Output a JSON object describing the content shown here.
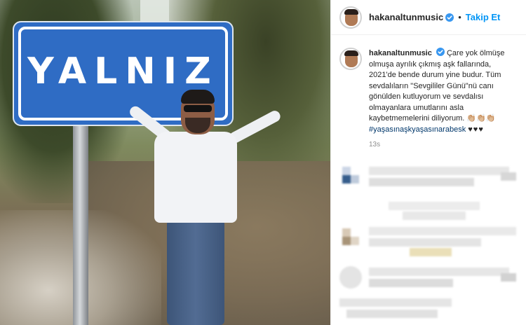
{
  "photo": {
    "sign_text": "YALNIZ"
  },
  "header": {
    "username": "hakanaltunmusic",
    "separator": "•",
    "follow_label": "Takip Et"
  },
  "caption": {
    "username": "hakanaltunmusic",
    "text": "Çare yok ölmüşe olmuşa ayrılık çıkmış aşk fallarında, 2021'de bende durum yine budur. Tüm sevdalıların \"Sevgililer Günü\"nü canı gönülden kutluyorum ve sevdalısı olmayanlara umutlarını asla kaybetmemelerini diliyorum. 👏🏼👏🏼👏🏼",
    "hashtag": "#yaşasınaşkyaşasınarabesk",
    "hearts": "♥♥♥",
    "time": "13s"
  },
  "colors": {
    "follow": "#0095f6",
    "verified": "#3897f0",
    "sign_blue": "#2f6cc4"
  },
  "icons": {
    "verified": "verified-badge-icon"
  }
}
